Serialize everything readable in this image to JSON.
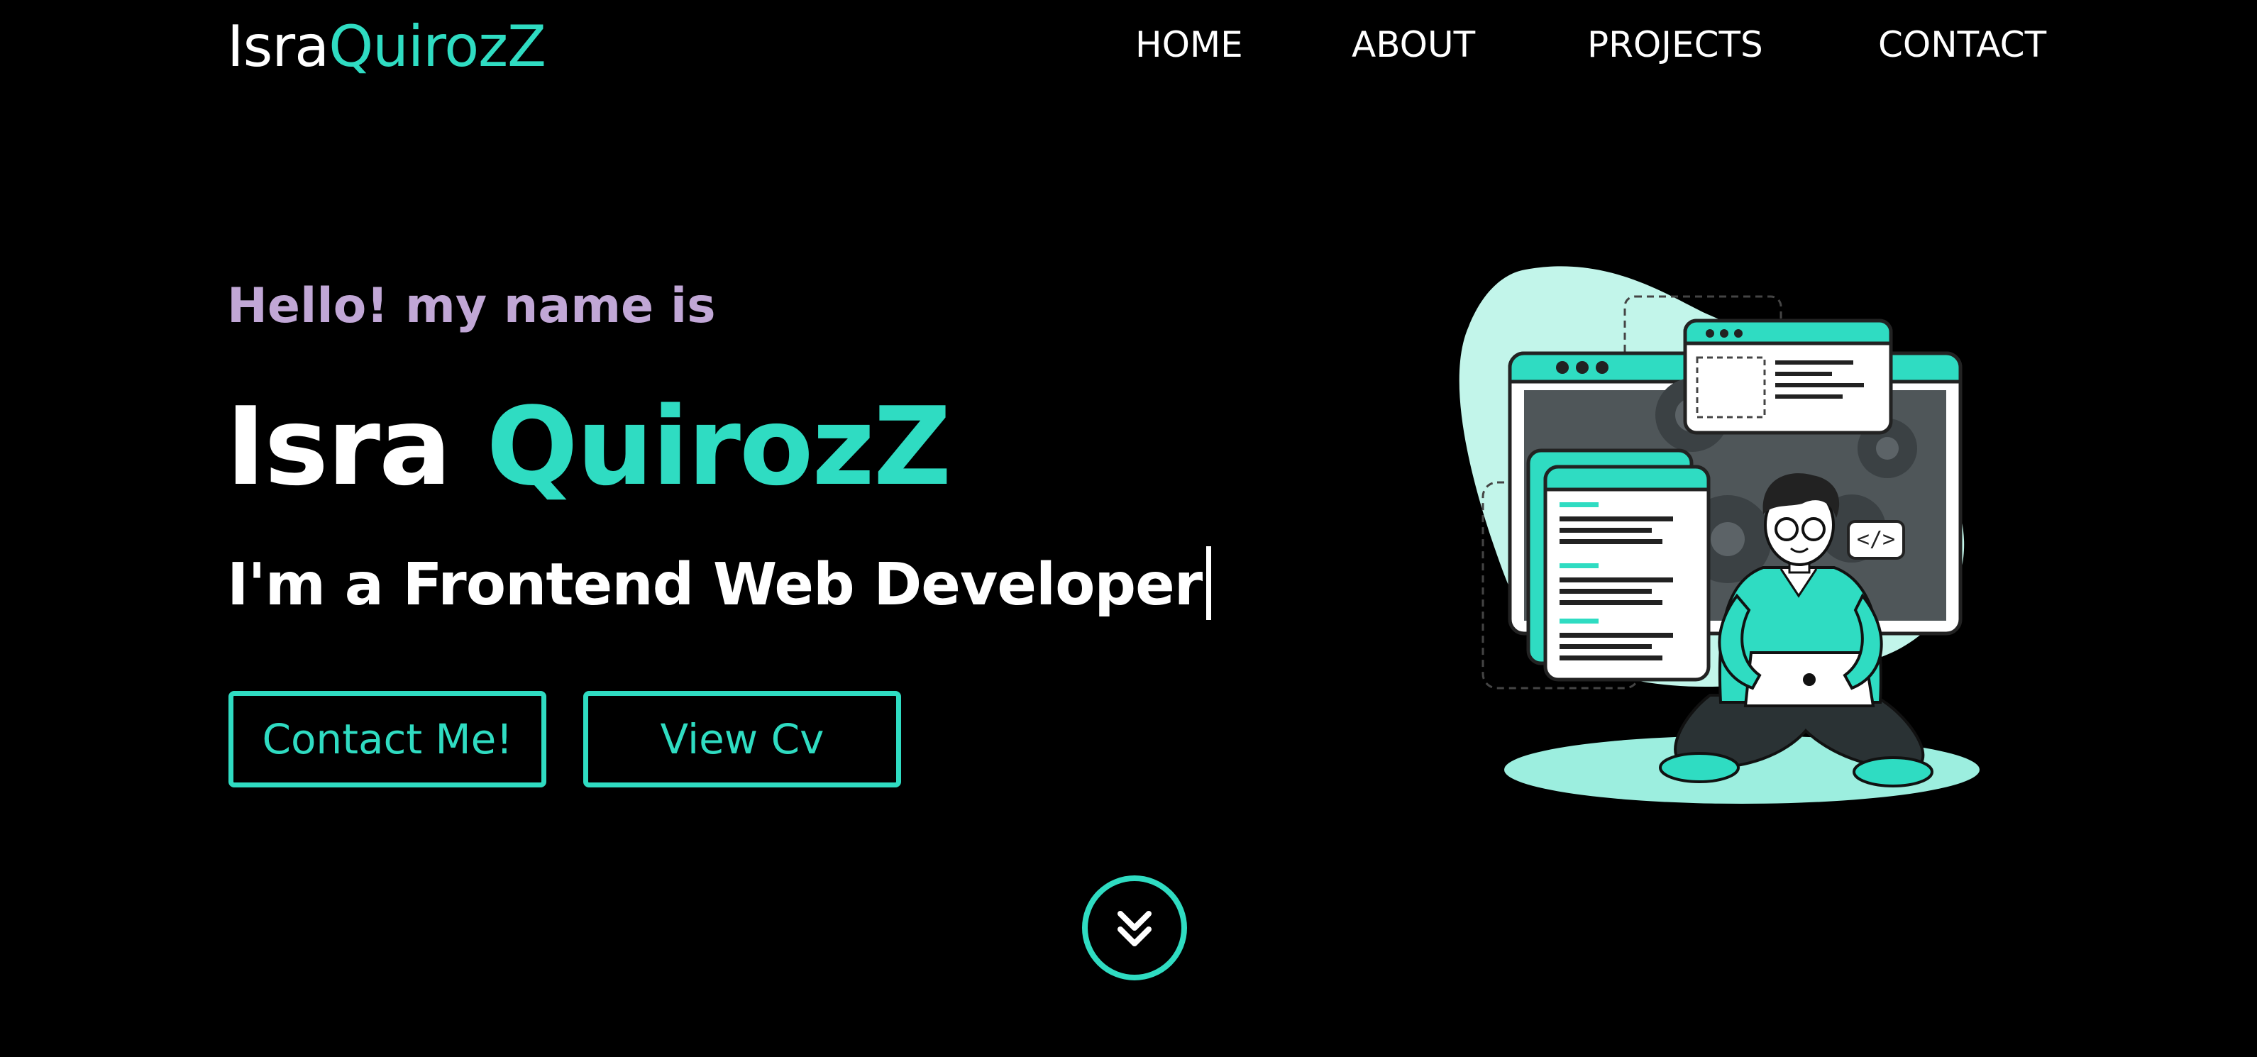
{
  "logo": {
    "first": "Isra",
    "second": "QuirozZ"
  },
  "nav": {
    "home": "HOME",
    "about": "ABOUT",
    "projects": "PROJECTS",
    "contact": "CONTACT"
  },
  "hero": {
    "greeting": "Hello! my name is",
    "first_name": "Isra",
    "last_name": "QuirozZ",
    "role": "I'm a Frontend Web Developer"
  },
  "buttons": {
    "contact": "Contact Me!",
    "cv": "View Cv"
  },
  "illustration": {
    "code_tag": "</>"
  },
  "icons": {
    "scroll": "double-chevron-down-icon"
  },
  "colors": {
    "background": "#000000",
    "accent": "#2fdcc2",
    "greeting": "#c1a7d6",
    "text": "#ffffff"
  }
}
